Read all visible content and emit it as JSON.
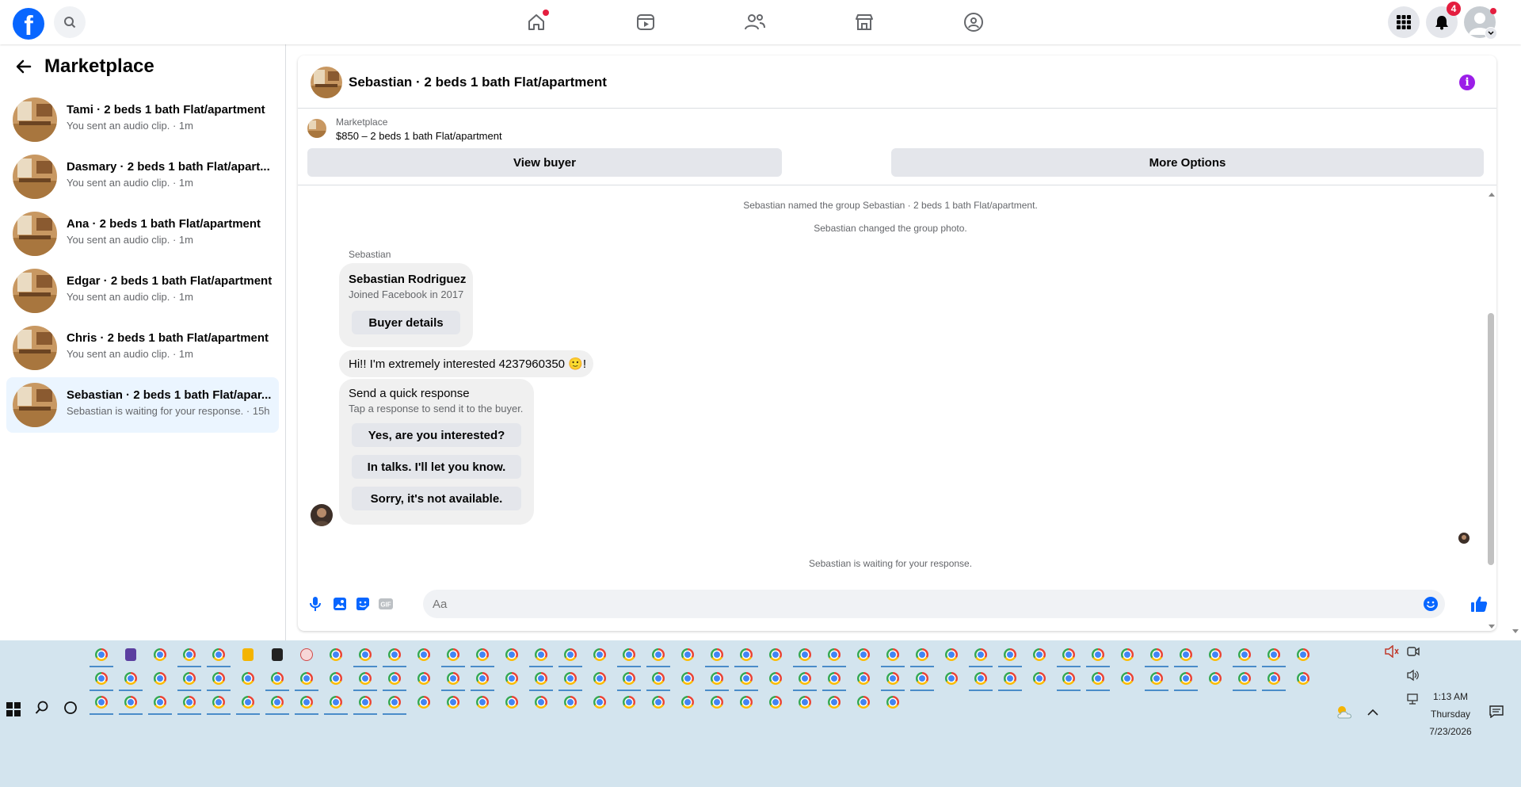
{
  "topbar": {
    "logo": "f",
    "icons": [
      "search-icon",
      "home-icon",
      "video-icon",
      "friends-icon",
      "marketplace-icon",
      "groups-icon",
      "menu-grid-icon",
      "bell-icon",
      "account-avatar"
    ],
    "notifications_count": "4"
  },
  "sidebar": {
    "title": "Marketplace",
    "conversations": [
      {
        "name": "Tami · 2 beds 1 bath Flat/apartment",
        "sub": "You sent an audio clip. · 1m"
      },
      {
        "name": "Dasmary · 2 beds 1 bath Flat/apart...",
        "sub": "You sent an audio clip. · 1m"
      },
      {
        "name": "Ana · 2 beds 1 bath Flat/apartment",
        "sub": "You sent an audio clip. · 1m"
      },
      {
        "name": "Edgar · 2 beds 1 bath Flat/apartment",
        "sub": "You sent an audio clip. · 1m"
      },
      {
        "name": "Chris · 2 beds 1 bath Flat/apartment",
        "sub": "You sent an audio clip. · 1m"
      },
      {
        "name": "Sebastian · 2 beds 1 bath Flat/apar...",
        "sub": "Sebastian is waiting for your response. · 15h"
      }
    ]
  },
  "chat": {
    "title": "Sebastian · 2 beds 1 bath Flat/apartment",
    "listing_label": "Marketplace",
    "listing_price": "$850 – 2 beds 1 bath Flat/apartment",
    "view_buyer": "View buyer",
    "more_options": "More Options",
    "system_messages": [
      "Sebastian named the group Sebastian · 2 beds 1 bath Flat/apartment.",
      "Sebastian changed the group photo."
    ],
    "sender": "Sebastian",
    "buyer_card": {
      "name": "Sebastian Rodriguez",
      "joined": "Joined Facebook in 2017",
      "button": "Buyer details"
    },
    "message": "Hi!! I'm extremely interested 4237960350 🙂!",
    "quick_response": {
      "title": "Send a quick response",
      "subtitle": "Tap a response to send it to the buyer.",
      "options": [
        "Yes, are you interested?",
        "In talks. I'll let you know.",
        "Sorry, it's not available."
      ]
    },
    "waiting": "Sebastian is waiting for your response.",
    "composer_placeholder": "Aa"
  },
  "taskbar": {
    "time": "1:13 AM",
    "day": "Thursday",
    "date": "7/23/2026"
  },
  "colors": {
    "facebook_blue": "#0866ff",
    "badge_red": "#e41e3f",
    "info_purple": "#9b1ee8",
    "taskbar_bg": "#d3e4ee"
  }
}
